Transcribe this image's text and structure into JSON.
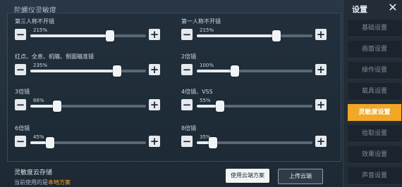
{
  "section_header": "陀螺仪灵敏度",
  "sliders": [
    {
      "label": "第三人称不开镜",
      "percent": "215%",
      "fraction": 0.69
    },
    {
      "label": "第一人称不开镜",
      "percent": "215%",
      "fraction": 0.69
    },
    {
      "label": "红点、全息、机瞄、侧面瞄准镜",
      "percent": "235%",
      "fraction": 0.75
    },
    {
      "label": "2倍镜",
      "percent": "100%",
      "fraction": 0.33
    },
    {
      "label": "3倍镜",
      "percent": "66%",
      "fraction": 0.23
    },
    {
      "label": "4倍镜、VSS",
      "percent": "55%",
      "fraction": 0.2
    },
    {
      "label": "6倍镜",
      "percent": "45%",
      "fraction": 0.17
    },
    {
      "label": "8倍镜",
      "percent": "35%",
      "fraction": 0.14
    }
  ],
  "cloud": {
    "title": "灵敏度云存储",
    "status_prefix": "当前使用的是",
    "status_value": "本地方案",
    "use_cloud_label": "使用云端方案",
    "upload_label": "上传云端"
  },
  "sidebar": {
    "title": "设置",
    "close_glyph": "✕",
    "tabs": [
      {
        "label": "基础设置"
      },
      {
        "label": "画面设置"
      },
      {
        "label": "操作设置"
      },
      {
        "label": "载具设置"
      },
      {
        "label": "灵敏度设置"
      },
      {
        "label": "拾取设置"
      },
      {
        "label": "效果设置"
      },
      {
        "label": "声音设置"
      }
    ]
  },
  "colors": {
    "accent": "#f2a726",
    "highlight": "#f5a623"
  }
}
